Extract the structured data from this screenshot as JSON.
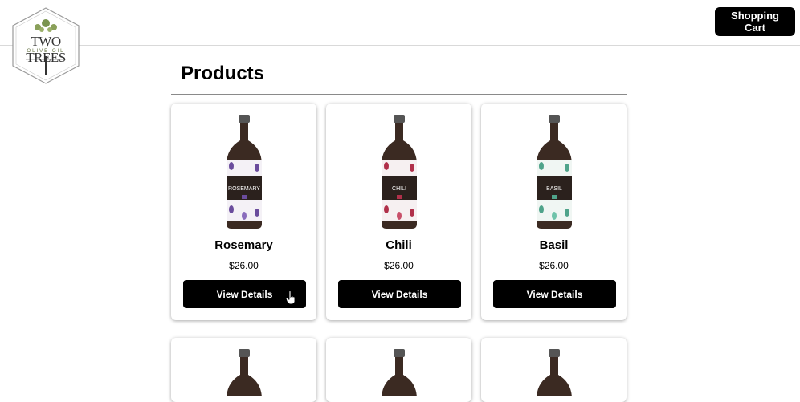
{
  "header": {
    "logo": {
      "name": "TWO TREES",
      "subtitle": "OLIVE OIL"
    },
    "cart_label": "Shopping Cart"
  },
  "main": {
    "title": "Products",
    "products": [
      {
        "name": "Rosemary",
        "price": "$26.00",
        "button": "View Details",
        "label_text": "ROSEMARY",
        "accent": "#6a4c9c"
      },
      {
        "name": "Chili",
        "price": "$26.00",
        "button": "View Details",
        "label_text": "CHILI",
        "accent": "#b0304a"
      },
      {
        "name": "Basil",
        "price": "$26.00",
        "button": "View Details",
        "label_text": "BASIL",
        "accent": "#4fa38a"
      }
    ]
  },
  "colors": {
    "button_bg": "#000000",
    "button_text": "#ffffff",
    "bottle": "#3b2a22"
  }
}
